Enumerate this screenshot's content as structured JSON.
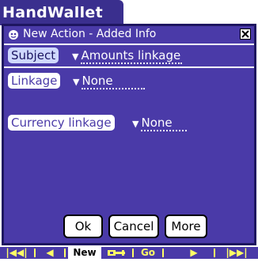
{
  "app": {
    "title": "HandWallet"
  },
  "dialog": {
    "title": "New Action - Added Info",
    "subject": {
      "label": "Subject",
      "value": "Amounts linkage"
    },
    "fields": [
      {
        "label": "Linkage",
        "value": "None"
      },
      {
        "label": "Currency linkage",
        "value": "None"
      }
    ],
    "buttons": {
      "ok": "Ok",
      "cancel": "Cancel",
      "more": "More"
    }
  },
  "bottom_bar": {
    "first": "|◀◀|",
    "prev": "◀",
    "new_label": "New",
    "go_label": "Go",
    "next": "▶",
    "last": "|▶▶|"
  },
  "icons": {
    "info": "info-icon",
    "close": "close-icon",
    "dropdown": "triangle-down-icon",
    "key": "key-icon"
  },
  "colors": {
    "dialog_bg": "#4a3aa8",
    "dialog_border": "#1e1660",
    "title_tab_bg": "#3a2f8e",
    "bar_text": "#ffff66"
  }
}
